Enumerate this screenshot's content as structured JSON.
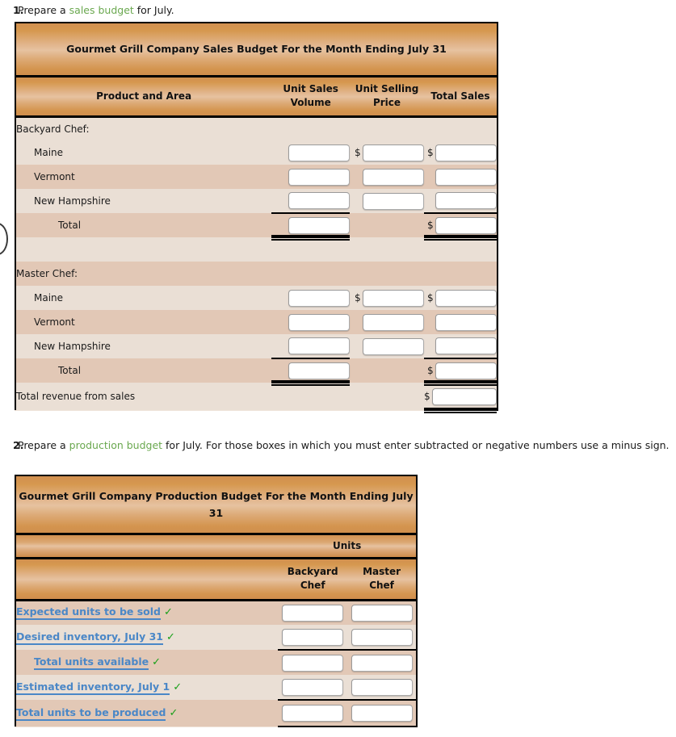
{
  "questions": [
    {
      "number": "1.",
      "prefix": "Prepare a ",
      "link": "sales budget",
      "suffix": " for July."
    },
    {
      "number": "2.",
      "prefix": "Prepare a ",
      "link": "production budget",
      "suffix": " for July. For those boxes in which you must enter subtracted or negative numbers use a minus sign."
    }
  ],
  "sales_budget": {
    "title_lines": [
      "Gourmet Grill Company",
      "Sales Budget",
      "For the Month Ending July 31"
    ],
    "columns": {
      "product_area": "Product and Area",
      "unit_sales_volume_l1": "Unit Sales",
      "unit_sales_volume_l2": "Volume",
      "unit_selling_price_l1": "Unit Selling",
      "unit_selling_price_l2": "Price",
      "total_sales": "Total Sales"
    },
    "sections": [
      {
        "heading": "Backyard Chef:",
        "rows": [
          {
            "label": "Maine",
            "volume": "",
            "price": "",
            "total": "",
            "price_dollar": true,
            "total_dollar": true
          },
          {
            "label": "Vermont",
            "volume": "",
            "price": "",
            "total": "",
            "price_dollar": false,
            "total_dollar": false
          },
          {
            "label": "New Hampshire",
            "volume": "",
            "price": "",
            "total": "",
            "price_dollar": false,
            "total_dollar": false
          }
        ],
        "total_label": "Total",
        "total_volume": "",
        "total_total": "",
        "total_dollar": true
      },
      {
        "heading": "Master Chef:",
        "rows": [
          {
            "label": "Maine",
            "volume": "",
            "price": "",
            "total": "",
            "price_dollar": true,
            "total_dollar": true
          },
          {
            "label": "Vermont",
            "volume": "",
            "price": "",
            "total": "",
            "price_dollar": false,
            "total_dollar": false
          },
          {
            "label": "New Hampshire",
            "volume": "",
            "price": "",
            "total": "",
            "price_dollar": false,
            "total_dollar": false
          }
        ],
        "total_label": "Total",
        "total_volume": "",
        "total_total": "",
        "total_dollar": true
      }
    ],
    "grand_total_label": "Total revenue from sales",
    "grand_total_value": "",
    "dollar_sign": "$"
  },
  "production_budget": {
    "title_lines": [
      "Gourmet Grill Company",
      "Production Budget",
      "For the Month Ending July 31"
    ],
    "units_header": "Units",
    "columns": {
      "backyard_l1": "Backyard",
      "backyard_l2": "Chef",
      "master_l1": "Master",
      "master_l2": "Chef"
    },
    "rows": [
      {
        "label": "Expected units to be sold",
        "checked": "✓",
        "backyard": "",
        "master": "",
        "indent": 0
      },
      {
        "label": "Desired inventory, July 31",
        "checked": "✓",
        "backyard": "",
        "master": "",
        "indent": 0
      },
      {
        "label": "Total units available",
        "checked": "✓",
        "backyard": "",
        "master": "",
        "indent": 1
      },
      {
        "label": "Estimated inventory, July 1",
        "checked": "✓",
        "backyard": "",
        "master": "",
        "indent": 0
      },
      {
        "label": "Total units to be produced",
        "checked": "✓",
        "backyard": "",
        "master": "",
        "indent": 0
      }
    ]
  },
  "colors": {
    "header_orange": "#d6984f",
    "row_dark": "#e2c8b6",
    "row_light": "#eadfd5",
    "link_green": "#6aa84f",
    "link_blue": "#4a87c7",
    "check_green": "#1aa01a"
  }
}
